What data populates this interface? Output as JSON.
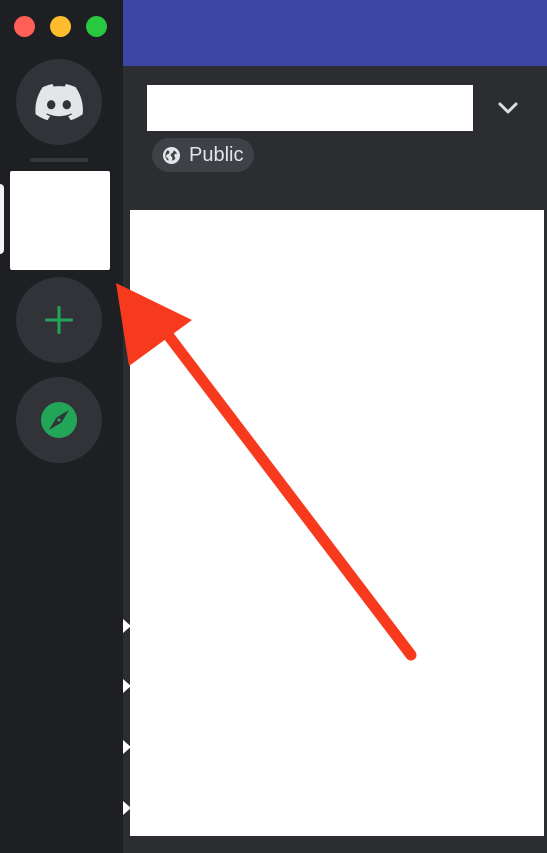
{
  "window": {
    "traffic_lights": [
      "close",
      "minimize",
      "zoom"
    ]
  },
  "server_rail": {
    "home": {
      "icon": "discord-logo-icon"
    },
    "add_server": {
      "icon": "plus-icon",
      "color": "#23a559"
    },
    "explore": {
      "icon": "compass-icon",
      "color": "#23a559"
    }
  },
  "channel_header": {
    "name_value": "",
    "visibility_label": "Public",
    "visibility_icon": "globe-icon",
    "dropdown_icon": "chevron-down-icon"
  },
  "colors": {
    "rail_bg": "#1e1f22",
    "main_bg": "#2b2d31",
    "topbar": "#3c46a4",
    "arrow": "#f73a1e"
  }
}
